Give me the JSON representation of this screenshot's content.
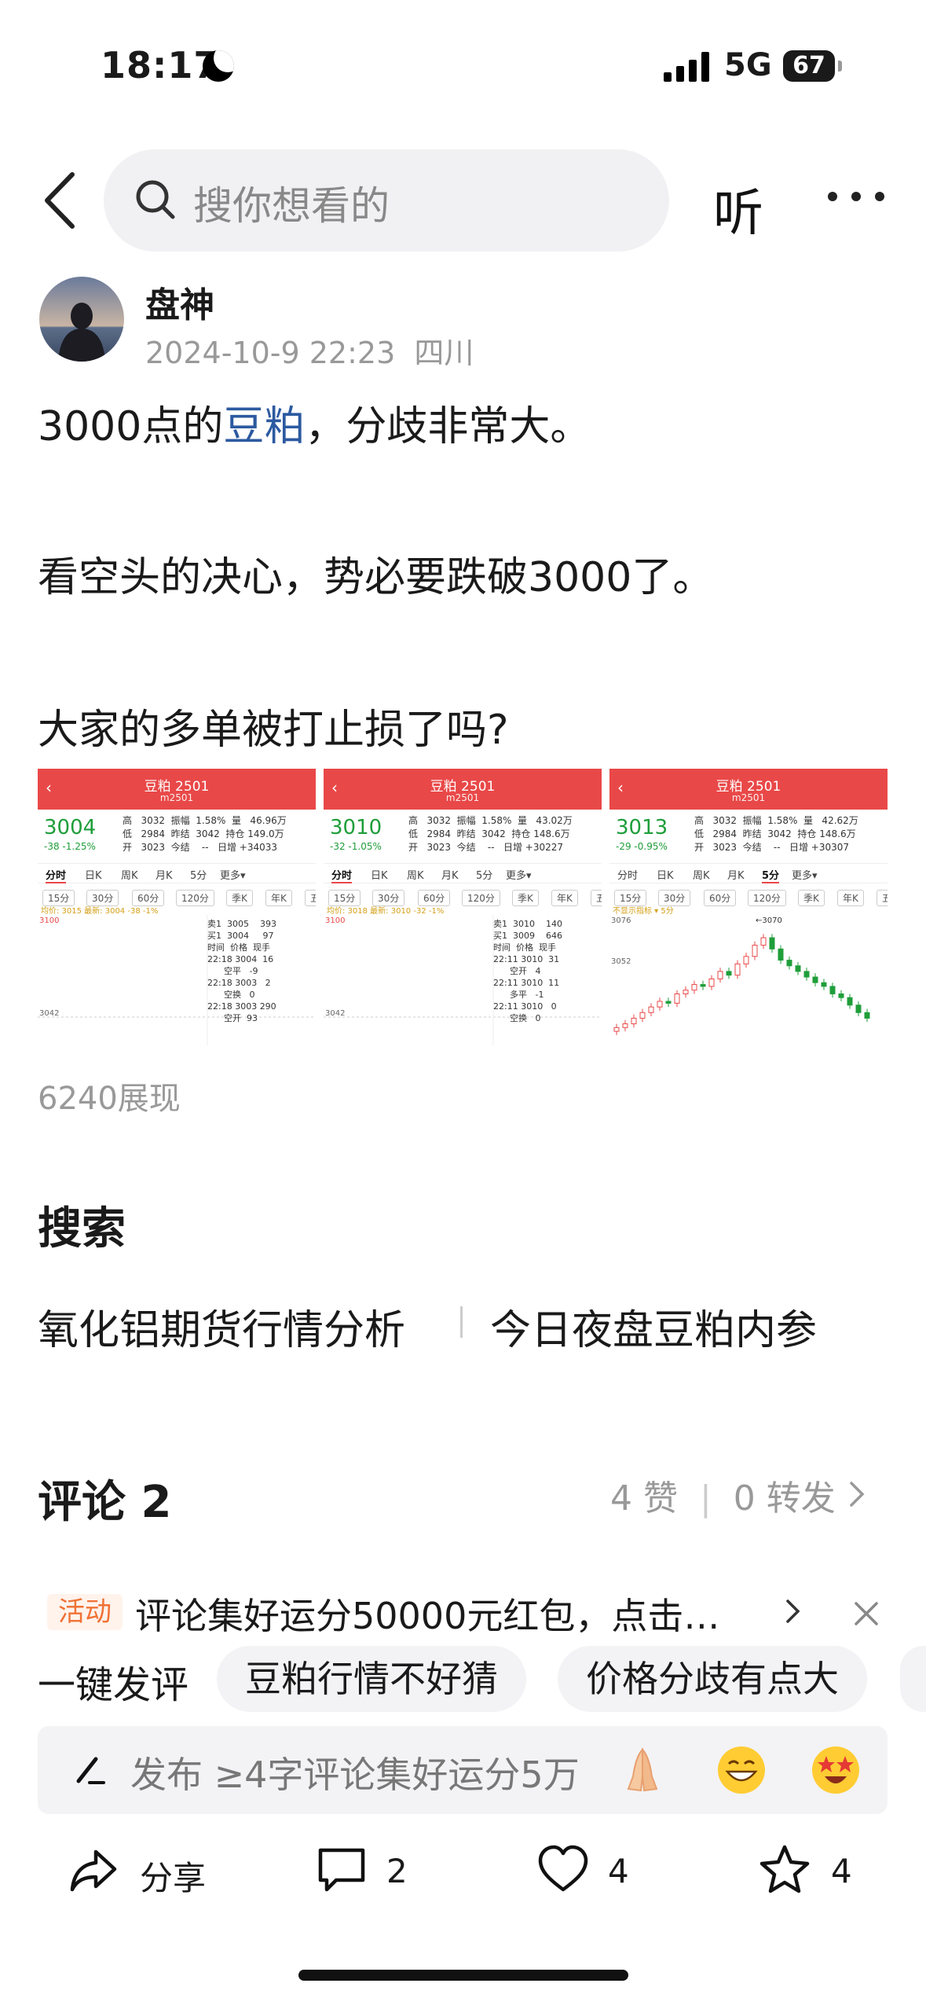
{
  "status_bar": {
    "time": "18:17",
    "network": "5G",
    "battery": "67"
  },
  "header": {
    "search_placeholder": "搜你想看的",
    "listen_label": "听"
  },
  "author": {
    "name": "盘神",
    "timestamp": "2024-10-9 22:23",
    "location": "四川"
  },
  "post": {
    "line1_prefix": "3000点的",
    "line1_link": "豆粕",
    "line1_suffix": "，分歧非常大。",
    "line2": "看空头的决心，势必要跌破3000了。",
    "line3": "大家的多单被打止损了吗?"
  },
  "chart_images": [
    {
      "title": "豆粕 2501",
      "symbol": "m2501",
      "price": "3004",
      "change": "-38  -1.25%",
      "stats": "高   3032  振幅  1.58%  量   46.96万\n低   2984  昨结  3042  持仓 149.0万\n开   3023  今结    --   日增 +34033",
      "tab_active": "分时",
      "latest": "均价: 3015  最新: 3004 -38 -1%",
      "top_price": "3100",
      "low_price": "3042",
      "orderbook": "卖1  3005    393\n买1  3004     97\n时间  价格  现手\n22:18 3004  16\n      空平   -9\n22:18 3003   2\n      空换   0\n22:18 3003 290\n      空开  93"
    },
    {
      "title": "豆粕 2501",
      "symbol": "m2501",
      "price": "3010",
      "change": "-32  -1.05%",
      "stats": "高   3032  振幅  1.58%  量   43.02万\n低   2984  昨结  3042  持仓 148.6万\n开   3023  今结    --   日增 +30227",
      "tab_active": "分时",
      "latest": "均价: 3018  最新: 3010 -32 -1%",
      "top_price": "3100",
      "low_price": "3042",
      "orderbook": "卖1  3010    140\n买1  3009    646\n时间  价格  现手\n22:11 3010  31\n      空开   4\n22:11 3010  11\n      多平   -1\n22:11 3010   0\n      空换   0"
    },
    {
      "title": "豆粕 2501",
      "symbol": "m2501",
      "price": "3013",
      "change": "-29  -0.95%",
      "stats": "高   3032  振幅  1.58%  量   42.62万\n低   2984  昨结  3042  持仓 148.6万\n开   3023  今结    --   日增 +30307",
      "tab_active": "5分",
      "latest": "不显示指标 ▾  5分",
      "top_price": "3076",
      "mid_price": "3052",
      "peak_label": "←3070",
      "candles": [
        3022,
        3024,
        3027,
        3030,
        3033,
        3036,
        3035,
        3040,
        3042,
        3045,
        3044,
        3048,
        3052,
        3050,
        3056,
        3060,
        3066,
        3070,
        3064,
        3058,
        3055,
        3052,
        3049,
        3046,
        3044,
        3040,
        3038,
        3034,
        3030,
        3027
      ]
    }
  ],
  "chart_tabs": [
    "分时",
    "日K",
    "周K",
    "月K",
    "5分",
    "更多▾"
  ],
  "chart_tabs2": [
    "15分",
    "30分",
    "60分",
    "120分",
    "季K",
    "年K",
    "五"
  ],
  "views_text": "6240展现",
  "search_section": {
    "title": "搜索",
    "items": [
      "氧化铝期货行情分析",
      "今日夜盘豆粕内参"
    ]
  },
  "comments": {
    "title": "评论 2",
    "likes_text": "4 赞",
    "forwards_text": "0 转发"
  },
  "promo": {
    "tag": "活动",
    "text": "评论集好运分50000元红包，点击…"
  },
  "quick_reply": {
    "label": "一键发评",
    "chips": [
      "豆粕行情不好猜",
      "价格分歧有点大"
    ]
  },
  "compose": {
    "placeholder": "发布 ≥4字评论集好运分5万"
  },
  "actions": {
    "share": "分享",
    "comment_count": "2",
    "like_count": "4",
    "favorite_count": "4"
  },
  "colors": {
    "accent_red": "#e94848",
    "down_green": "#1f9e3a",
    "link_blue": "#2c5aa0"
  }
}
